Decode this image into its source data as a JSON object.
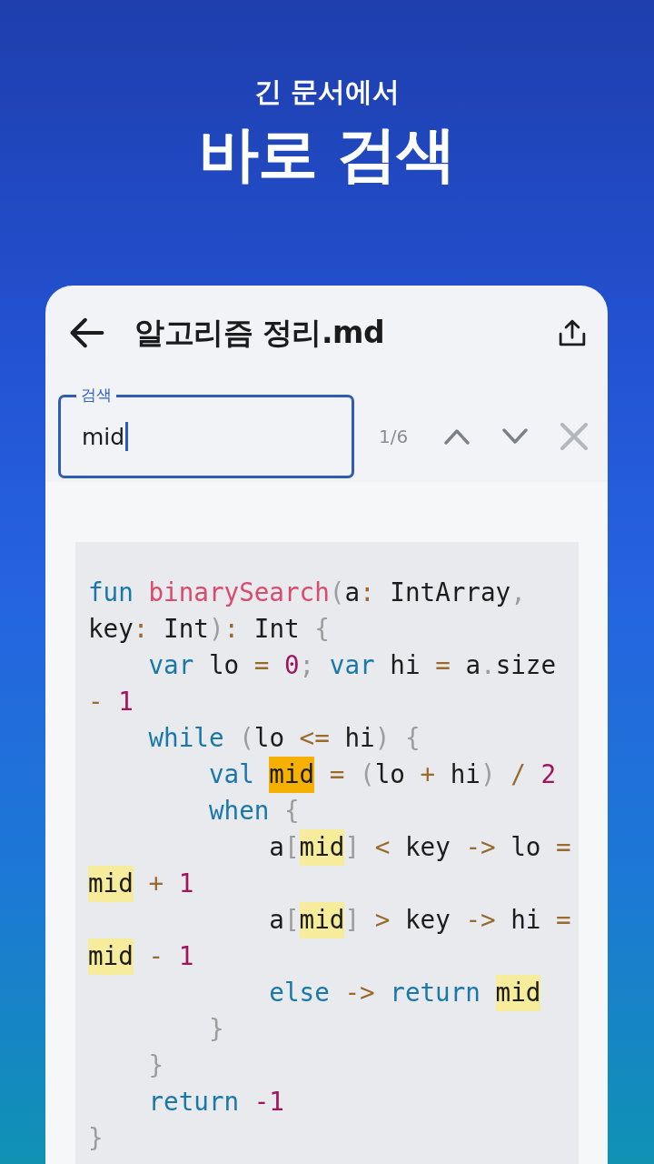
{
  "headline": {
    "subtitle": "긴 문서에서",
    "title": "바로 검색"
  },
  "document": {
    "title": "알고리즘 정리.md"
  },
  "search": {
    "label": "검색",
    "value": "mid",
    "counter": "1/6"
  },
  "code_block": {
    "lines": [
      {
        "tokens": [
          {
            "kind": "keyword",
            "text": "fun "
          },
          {
            "kind": "function",
            "text": "binarySearch"
          },
          {
            "kind": "punct",
            "text": "("
          },
          {
            "kind": "plain",
            "text": "a"
          },
          {
            "kind": "operator",
            "text": ":"
          },
          {
            "kind": "plain",
            "text": " IntArray"
          },
          {
            "kind": "punct",
            "text": ","
          }
        ]
      },
      {
        "tokens": [
          {
            "kind": "plain",
            "text": "key"
          },
          {
            "kind": "operator",
            "text": ":"
          },
          {
            "kind": "plain",
            "text": " Int"
          },
          {
            "kind": "punct",
            "text": ")"
          },
          {
            "kind": "operator",
            "text": ":"
          },
          {
            "kind": "plain",
            "text": " Int "
          },
          {
            "kind": "punct",
            "text": "{"
          }
        ]
      },
      {
        "tokens": [
          {
            "kind": "keyword",
            "text": "    var"
          },
          {
            "kind": "plain",
            "text": " lo "
          },
          {
            "kind": "operator",
            "text": "= "
          },
          {
            "kind": "number",
            "text": "0"
          },
          {
            "kind": "punct",
            "text": "; "
          },
          {
            "kind": "keyword",
            "text": "var"
          },
          {
            "kind": "plain",
            "text": " hi "
          },
          {
            "kind": "operator",
            "text": "="
          },
          {
            "kind": "plain",
            "text": " a"
          },
          {
            "kind": "punct",
            "text": "."
          },
          {
            "kind": "plain",
            "text": "size"
          }
        ]
      },
      {
        "tokens": [
          {
            "kind": "operator",
            "text": "- "
          },
          {
            "kind": "number",
            "text": "1"
          }
        ]
      },
      {
        "tokens": [
          {
            "kind": "keyword",
            "text": "    while "
          },
          {
            "kind": "punct",
            "text": "("
          },
          {
            "kind": "plain",
            "text": "lo "
          },
          {
            "kind": "operator",
            "text": "<="
          },
          {
            "kind": "plain",
            "text": " hi"
          },
          {
            "kind": "punct",
            "text": ") {"
          }
        ]
      },
      {
        "tokens": [
          {
            "kind": "keyword",
            "text": "        val "
          },
          {
            "kind": "match",
            "text": "mid",
            "selected": true
          },
          {
            "kind": "operator",
            "text": " = "
          },
          {
            "kind": "punct",
            "text": "("
          },
          {
            "kind": "plain",
            "text": "lo "
          },
          {
            "kind": "operator",
            "text": "+"
          },
          {
            "kind": "plain",
            "text": " hi"
          },
          {
            "kind": "punct",
            "text": ") "
          },
          {
            "kind": "operator",
            "text": "/ "
          },
          {
            "kind": "number",
            "text": "2"
          }
        ]
      },
      {
        "tokens": [
          {
            "kind": "keyword",
            "text": "        when "
          },
          {
            "kind": "punct",
            "text": "{"
          }
        ]
      },
      {
        "tokens": [
          {
            "kind": "plain",
            "text": "            a"
          },
          {
            "kind": "punct",
            "text": "["
          },
          {
            "kind": "match",
            "text": "mid",
            "selected": false
          },
          {
            "kind": "punct",
            "text": "] "
          },
          {
            "kind": "operator",
            "text": "<"
          },
          {
            "kind": "plain",
            "text": " key "
          },
          {
            "kind": "operator",
            "text": "->"
          },
          {
            "kind": "plain",
            "text": " lo "
          },
          {
            "kind": "operator",
            "text": "="
          }
        ]
      },
      {
        "tokens": [
          {
            "kind": "match",
            "text": "mid",
            "selected": false
          },
          {
            "kind": "operator",
            "text": " + "
          },
          {
            "kind": "number",
            "text": "1"
          }
        ]
      },
      {
        "tokens": [
          {
            "kind": "plain",
            "text": "            a"
          },
          {
            "kind": "punct",
            "text": "["
          },
          {
            "kind": "match",
            "text": "mid",
            "selected": false
          },
          {
            "kind": "punct",
            "text": "] "
          },
          {
            "kind": "operator",
            "text": ">"
          },
          {
            "kind": "plain",
            "text": " key "
          },
          {
            "kind": "operator",
            "text": "->"
          },
          {
            "kind": "plain",
            "text": " hi "
          },
          {
            "kind": "operator",
            "text": "="
          }
        ]
      },
      {
        "tokens": [
          {
            "kind": "match",
            "text": "mid",
            "selected": false
          },
          {
            "kind": "operator",
            "text": " - "
          },
          {
            "kind": "number",
            "text": "1"
          }
        ]
      },
      {
        "tokens": [
          {
            "kind": "keyword",
            "text": "            else "
          },
          {
            "kind": "operator",
            "text": "-> "
          },
          {
            "kind": "keyword",
            "text": "return "
          },
          {
            "kind": "match",
            "text": "mid",
            "selected": false
          }
        ]
      },
      {
        "tokens": [
          {
            "kind": "punct",
            "text": "        }"
          }
        ]
      },
      {
        "tokens": [
          {
            "kind": "punct",
            "text": "    }"
          }
        ]
      },
      {
        "tokens": [
          {
            "kind": "keyword",
            "text": "    return "
          },
          {
            "kind": "number",
            "text": "-1"
          }
        ]
      },
      {
        "tokens": [
          {
            "kind": "punct",
            "text": "}"
          }
        ]
      }
    ]
  }
}
